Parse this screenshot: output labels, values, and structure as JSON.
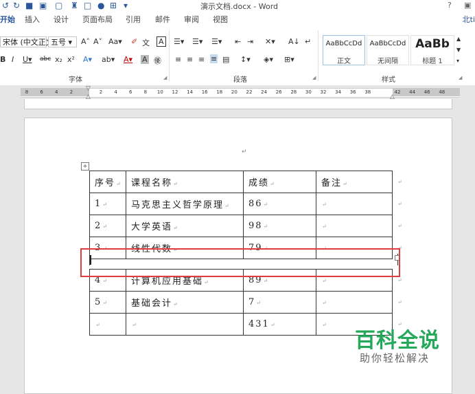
{
  "window": {
    "title": "演示文档.docx - Word",
    "help": "?",
    "account": "北ti"
  },
  "tabs": [
    "开始",
    "插入",
    "设计",
    "页面布局",
    "引用",
    "邮件",
    "审阅",
    "视图"
  ],
  "ribbon": {
    "font_name": "宋体 (中文正文",
    "font_size": "五号",
    "groups": {
      "font": "字体",
      "paragraph": "段落",
      "styles": "样式"
    },
    "styles": [
      {
        "sample": "AaBbCcDd",
        "name": "正文"
      },
      {
        "sample": "AaBbCcDd",
        "name": "无间隔"
      },
      {
        "sample": "AaBb",
        "name": "标题 1"
      }
    ]
  },
  "ruler": {
    "ticks": [
      "8",
      "6",
      "4",
      "2",
      "",
      "2",
      "4",
      "6",
      "8",
      "10",
      "12",
      "14",
      "16",
      "18",
      "20",
      "22",
      "24",
      "26",
      "28",
      "30",
      "32",
      "34",
      "36",
      "38",
      "",
      "42",
      "44",
      "46",
      "48"
    ]
  },
  "document": {
    "para_mark": "↵",
    "move_handle": "+",
    "table": {
      "rows": [
        [
          "序号",
          "课程名称",
          "成绩",
          "备注"
        ],
        [
          "1",
          "马克思主义哲学原理",
          "86",
          ""
        ],
        [
          "2",
          "大学英语",
          "98",
          ""
        ],
        [
          "3",
          "线性代数",
          "79",
          ""
        ],
        [
          "4",
          "计算机应用基础",
          "89",
          ""
        ],
        [
          "5",
          "基础会计",
          "7",
          ""
        ],
        [
          "",
          "",
          "431",
          ""
        ]
      ]
    }
  },
  "watermark": {
    "title": "百科全说",
    "subtitle": "助你轻松解决"
  },
  "colors": {
    "accent": "#2b579a",
    "highlight_box": "#e23b3b",
    "watermark": "#24a85a"
  }
}
